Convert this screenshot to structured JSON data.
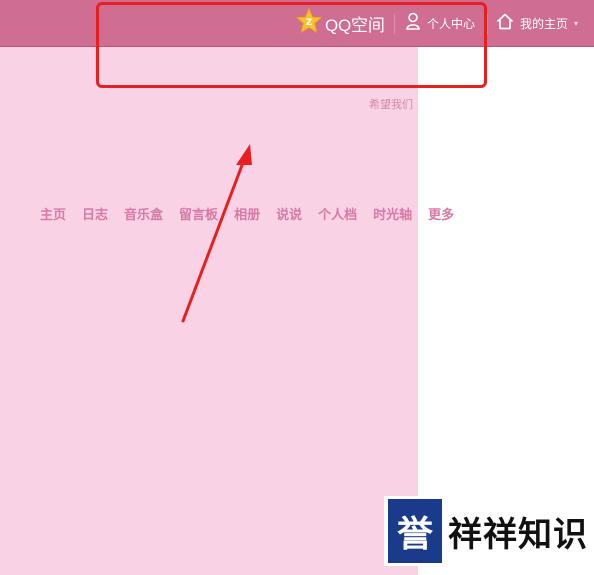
{
  "topbar": {
    "brand_label": "QQ空间",
    "personal_center_label": "个人中心",
    "my_home_label": "我的主页",
    "my_home_caret": "▾"
  },
  "page": {
    "hope_link": "希望我们"
  },
  "nav": {
    "items": [
      "主页",
      "日志",
      "音乐盒",
      "留言板",
      "相册",
      "说说",
      "个人档",
      "时光轴",
      "更多"
    ]
  },
  "watermark": {
    "block_char": "誉",
    "rest_text": "祥祥知识"
  },
  "colors": {
    "topbar_bg": "#cf6d92",
    "page_bg": "#f9d2e5",
    "nav_text": "#d67aa6",
    "annotation_red": "#e81f1f",
    "watermark_blue": "#1a3a8a"
  },
  "icons": [
    "qzone-star-icon",
    "user-icon",
    "home-icon",
    "chevron-down-icon"
  ]
}
